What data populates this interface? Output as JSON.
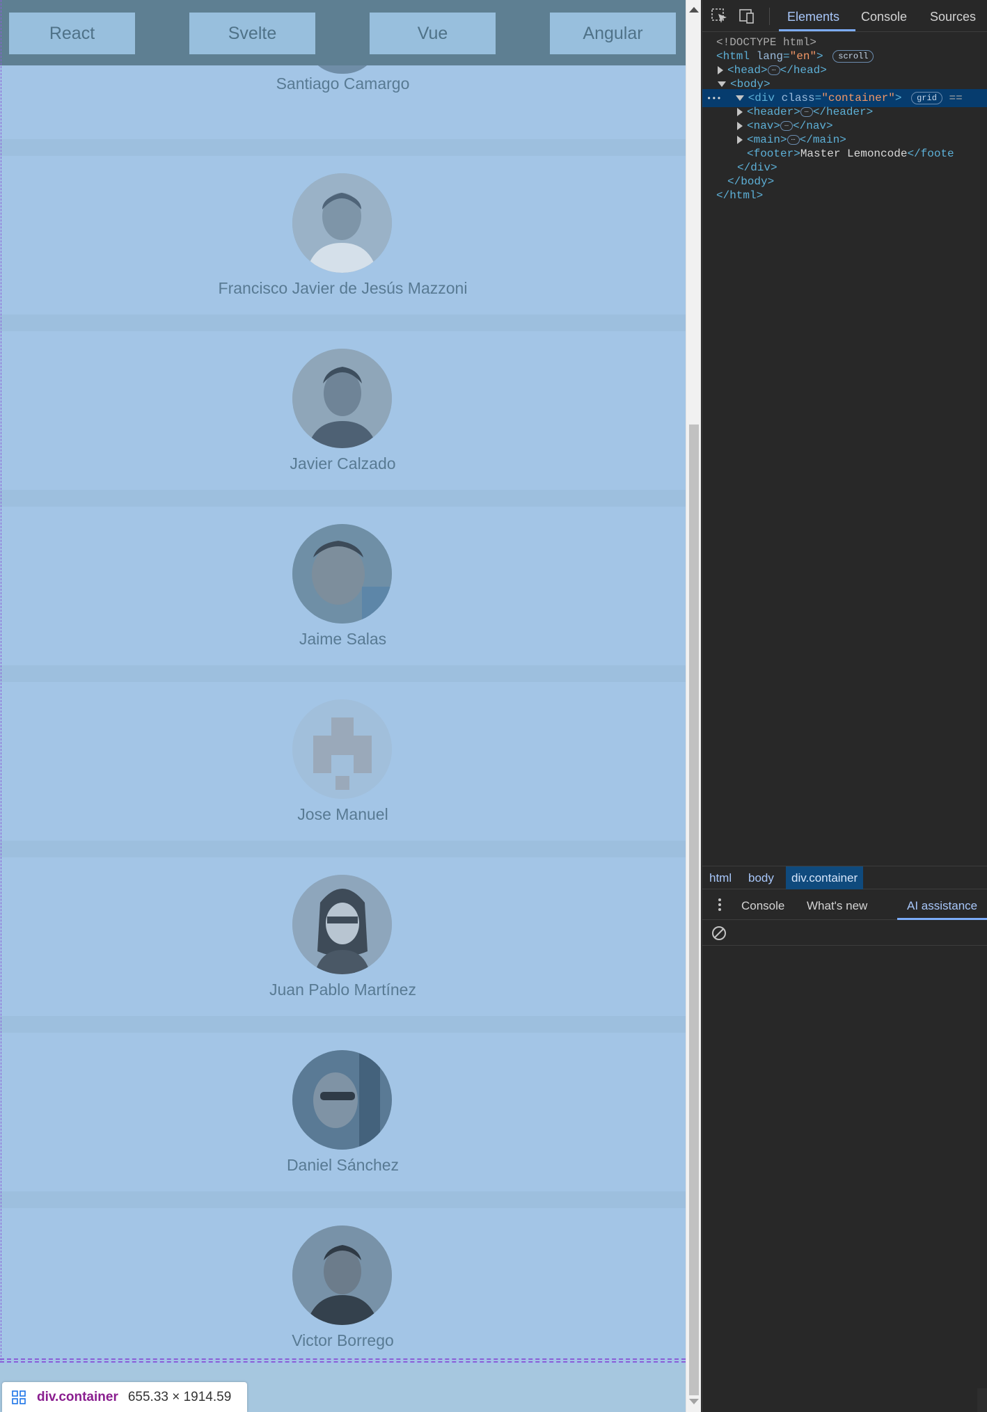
{
  "page": {
    "nav_buttons": [
      "React",
      "Svelte",
      "Vue",
      "Angular"
    ],
    "members": [
      "Santiago Camargo",
      "Francisco Javier de Jesús Mazzoni",
      "Javier Calzado",
      "Jaime Salas",
      "Jose Manuel",
      "Juan Pablo Martínez",
      "Daniel Sánchez",
      "Victor Borrego"
    ],
    "inspect_badge": {
      "tag": "div.container",
      "dims": "655.33 × 1914.59"
    }
  },
  "devtools": {
    "tabs": [
      "Elements",
      "Console",
      "Sources"
    ],
    "active_tab": "Elements",
    "dom": {
      "doctype": "<!DOCTYPE html>",
      "html_open": "<html",
      "html_attr": "lang",
      "html_attr_val": "\"en\"",
      "html_close": ">",
      "html_pill": "scroll",
      "head_open": "<head>",
      "head_close": "</head>",
      "body_open": "<body>",
      "div_open": "<div",
      "div_attr": "class",
      "div_attr_val": "\"container\"",
      "div_close": ">",
      "div_pill": "grid",
      "div_eq": "==",
      "header_open": "<header>",
      "header_close": "</header>",
      "nav_open": "<nav>",
      "nav_close": "</nav>",
      "main_open": "<main>",
      "main_close": "</main>",
      "footer_open": "<footer>",
      "footer_text": "Master Lemoncode",
      "footer_close": "</foote",
      "div_end": "</div>",
      "body_end": "</body>",
      "html_end": "</html>",
      "ellipsis": "…",
      "gutter_dots": "•••"
    },
    "breadcrumbs": [
      "html",
      "body",
      "div.container"
    ],
    "drawer_tabs": [
      "Console",
      "What's new",
      "AI assistance"
    ],
    "active_drawer_tab": "AI assistance"
  },
  "colors": {
    "overlay_blue": "#a3c5e6",
    "nav_bar": "#5e7f92",
    "devtools_bg": "#282828",
    "accent": "#7cacf8"
  }
}
